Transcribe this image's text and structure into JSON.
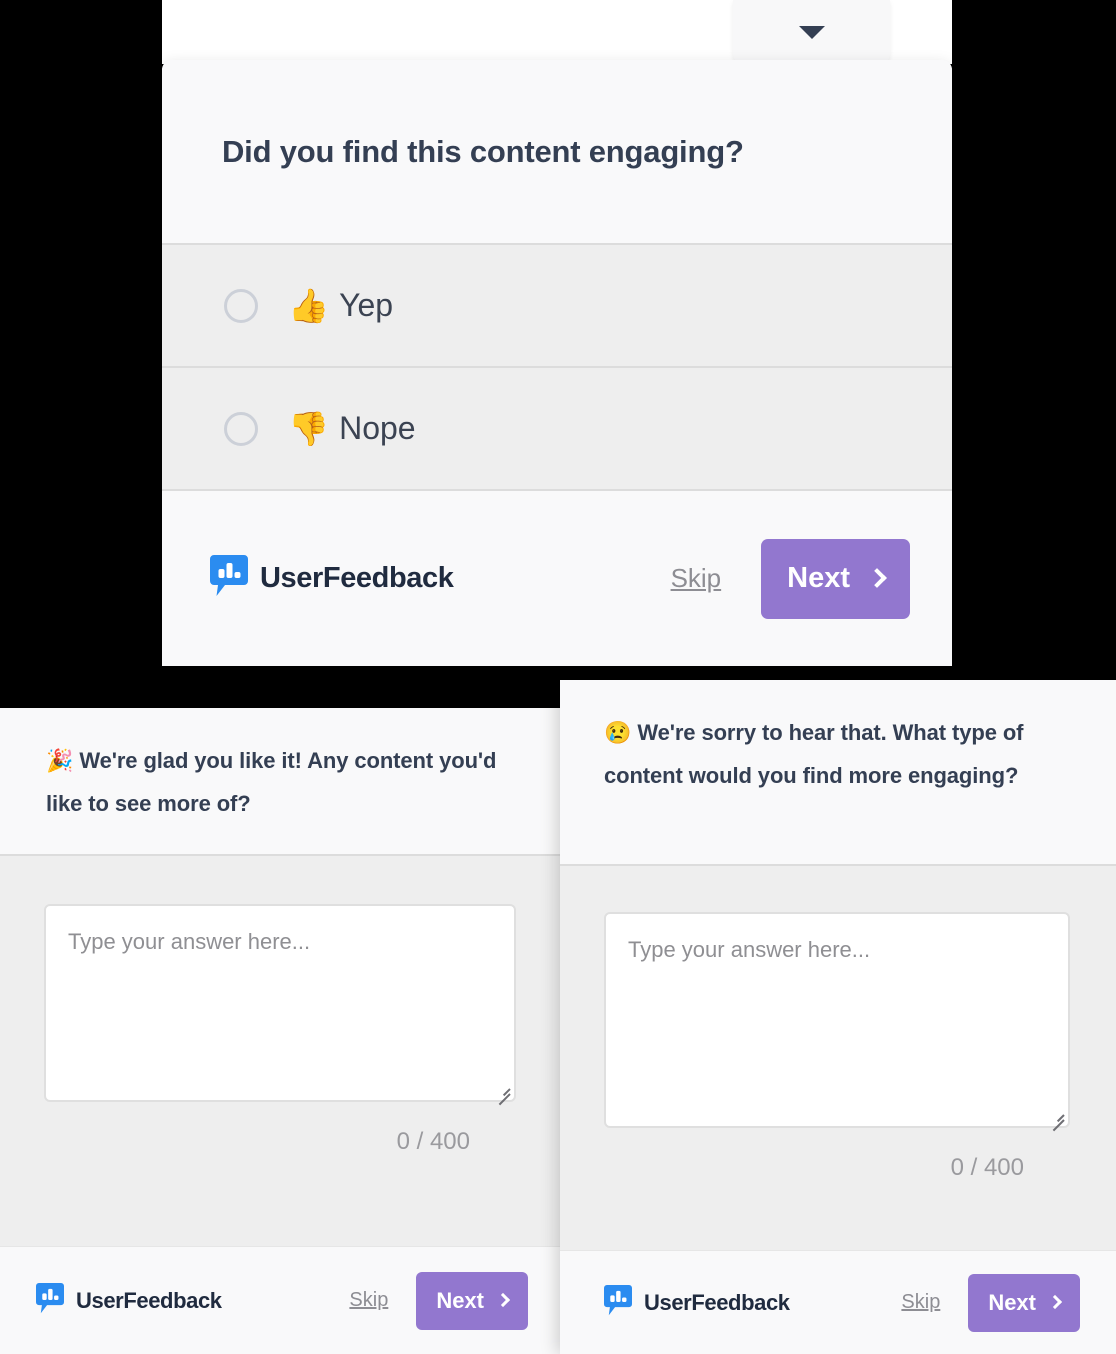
{
  "main_widget": {
    "collapse_tab": {
      "icon": "caret-down-icon"
    },
    "question": "Did you find this content engaging?",
    "options": [
      {
        "emoji": "👍",
        "label": "Yep",
        "selected": false
      },
      {
        "emoji": "👎",
        "label": "Nope",
        "selected": false
      }
    ],
    "footer": {
      "brand": "UserFeedback",
      "brand_icon": "userfeedback-logo-icon",
      "skip_label": "Skip",
      "next_label": "Next",
      "next_icon": "chevron-right-icon"
    }
  },
  "panel_positive": {
    "emoji": "🎉",
    "question": "We're glad you like it! Any content you'd like to see more of?",
    "textarea": {
      "value": "",
      "placeholder": "Type your answer here..."
    },
    "char_count": "0 / 400",
    "footer": {
      "brand": "UserFeedback",
      "brand_icon": "userfeedback-logo-icon",
      "skip_label": "Skip",
      "next_label": "Next",
      "next_icon": "chevron-right-icon"
    }
  },
  "panel_negative": {
    "emoji": "😢",
    "question": "We're sorry to hear that. What type of content would you find more engaging?",
    "textarea": {
      "value": "",
      "placeholder": "Type your answer here..."
    },
    "char_count": "0 / 400",
    "footer": {
      "brand": "UserFeedback",
      "brand_icon": "userfeedback-logo-icon",
      "skip_label": "Skip",
      "next_label": "Next",
      "next_icon": "chevron-right-icon"
    }
  },
  "colors": {
    "accent_purple": "#9277cf",
    "brand_blue": "#2b8cf0",
    "text_dark": "#343f53",
    "brand_text": "#202b3f",
    "panel_bg": "#eeeeee",
    "header_bg": "#f9f9fa",
    "divider": "#dcdcdc",
    "muted_text": "#8d8d93"
  }
}
